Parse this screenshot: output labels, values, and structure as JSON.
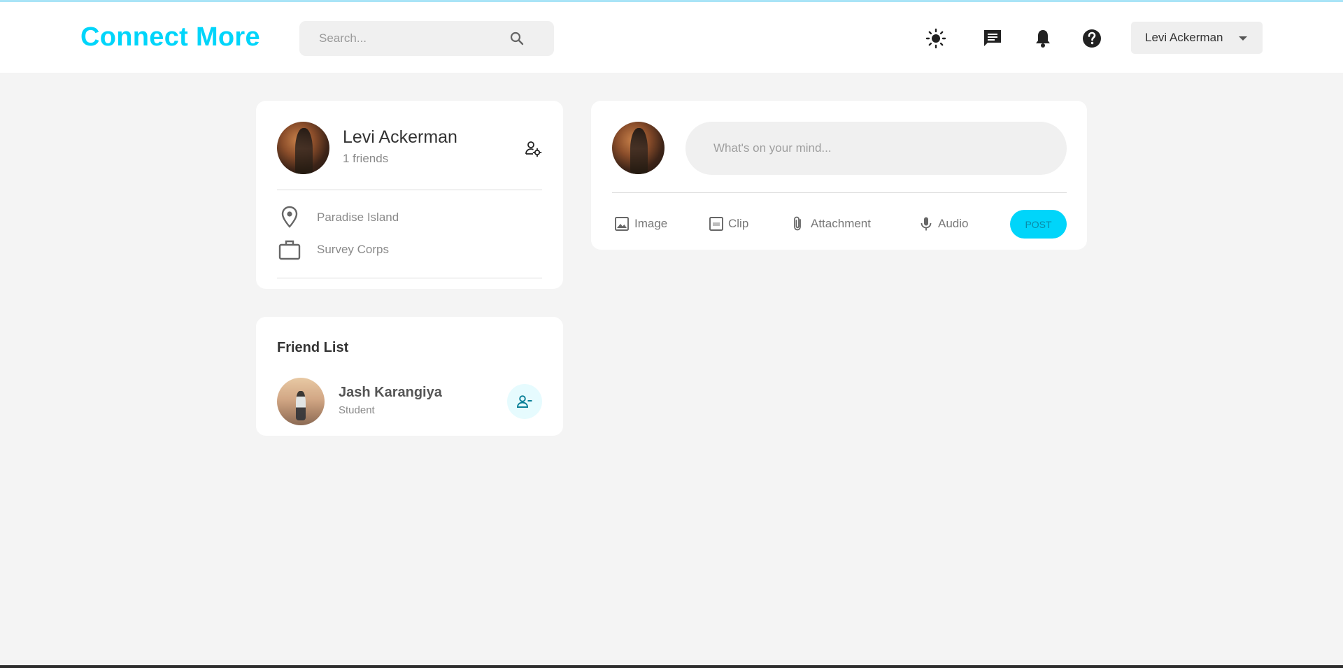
{
  "navbar": {
    "logo": "Connect More",
    "search_placeholder": "Search...",
    "user_name": "Levi Ackerman"
  },
  "profile": {
    "name": "Levi Ackerman",
    "friends": "1 friends",
    "location": "Paradise Island",
    "occupation": "Survey Corps"
  },
  "friend_list": {
    "title": "Friend List",
    "friends": [
      {
        "name": "Jash Karangiya",
        "role": "Student"
      }
    ]
  },
  "composer": {
    "placeholder": "What's on your mind...",
    "actions": {
      "image": "Image",
      "clip": "Clip",
      "attachment": "Attachment",
      "audio": "Audio"
    },
    "post_label": "POST"
  },
  "colors": {
    "accent": "#00d5fa",
    "background": "#f4f4f4"
  }
}
